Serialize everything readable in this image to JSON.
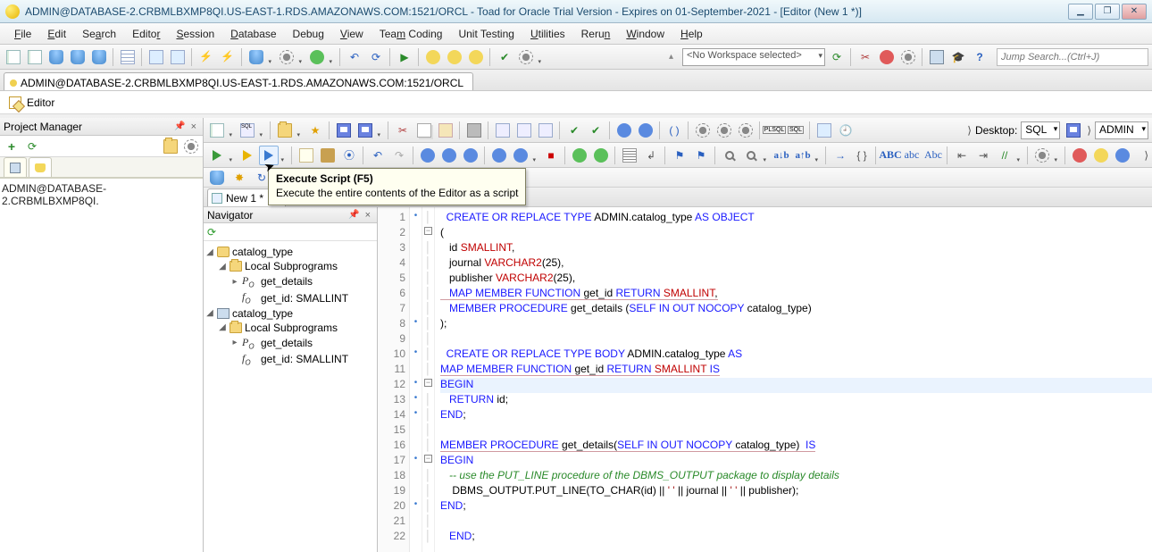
{
  "title": "ADMIN@DATABASE-2.CRBMLBXMP8QI.US-EAST-1.RDS.AMAZONAWS.COM:1521/ORCL - Toad for Oracle Trial Version - Expires on 01-September-2021 - [Editor (New 1 *)]",
  "menu": [
    "File",
    "Edit",
    "Search",
    "Editor",
    "Session",
    "Database",
    "Debug",
    "View",
    "Team Coding",
    "Unit Testing",
    "Utilities",
    "Rerun",
    "Window",
    "Help"
  ],
  "workspace_combo": "<No Workspace selected>",
  "jump_placeholder": "Jump Search...(Ctrl+J)",
  "connection_tab": "ADMIN@DATABASE-2.CRBMLBXMP8QI.US-EAST-1.RDS.AMAZONAWS.COM:1521/ORCL",
  "editor_label": "Editor",
  "project_manager": {
    "title": "Project Manager",
    "tree_root": "ADMIN@DATABASE-2.CRBMLBXMP8QI."
  },
  "desktop_label": "Desktop:",
  "desktop_value": "SQL",
  "user_value": "ADMIN",
  "tooltip": {
    "title": "Execute Script (F5)",
    "body": "Execute the entire contents of the Editor as a script"
  },
  "file_tab": {
    "label": "New 1 *",
    "prefix": "sql"
  },
  "navigator": {
    "title": "Navigator",
    "nodes": [
      {
        "lvl": 0,
        "tw": "◢",
        "icon": "type",
        "label": "catalog_type"
      },
      {
        "lvl": 1,
        "tw": "◢",
        "icon": "folder",
        "label": "Local Subprograms"
      },
      {
        "lvl": 2,
        "tw": "▸",
        "icon": "po",
        "label": "get_details"
      },
      {
        "lvl": 2,
        "tw": "",
        "icon": "fo",
        "label": "get_id: SMALLINT"
      },
      {
        "lvl": 0,
        "tw": "◢",
        "icon": "body",
        "label": "catalog_type"
      },
      {
        "lvl": 1,
        "tw": "◢",
        "icon": "folder",
        "label": "Local Subprograms"
      },
      {
        "lvl": 2,
        "tw": "▸",
        "icon": "po",
        "label": "get_details"
      },
      {
        "lvl": 2,
        "tw": "",
        "icon": "fo",
        "label": "get_id: SMALLINT"
      }
    ]
  },
  "code": {
    "lines": [
      {
        "n": 1,
        "mark": "•",
        "fold": "",
        "segs": [
          [
            "  ",
            ""
          ],
          [
            "CREATE OR REPLACE TYPE",
            "kw"
          ],
          [
            " ADMIN.catalog_type ",
            ""
          ],
          [
            "AS OBJECT",
            "kw"
          ]
        ]
      },
      {
        "n": 2,
        "mark": "",
        "fold": "[-]",
        "segs": [
          [
            "(",
            ""
          ]
        ]
      },
      {
        "n": 3,
        "mark": "",
        "fold": "",
        "segs": [
          [
            "   id ",
            ""
          ],
          [
            "SMALLINT",
            "ty"
          ],
          [
            ",",
            ""
          ]
        ]
      },
      {
        "n": 4,
        "mark": "",
        "fold": "",
        "segs": [
          [
            "   journal ",
            ""
          ],
          [
            "VARCHAR2",
            "ty"
          ],
          [
            "(",
            ""
          ],
          [
            "25",
            ""
          ],
          [
            "),",
            ""
          ]
        ]
      },
      {
        "n": 5,
        "mark": "",
        "fold": "",
        "segs": [
          [
            "   publisher ",
            ""
          ],
          [
            "VARCHAR2",
            "ty"
          ],
          [
            "(",
            ""
          ],
          [
            "25",
            ""
          ],
          [
            "),",
            ""
          ]
        ]
      },
      {
        "n": 6,
        "mark": "",
        "fold": "",
        "uline": true,
        "segs": [
          [
            "   ",
            ""
          ],
          [
            "MAP MEMBER FUNCTION",
            "kw"
          ],
          [
            " get_id ",
            ""
          ],
          [
            "RETURN",
            "kw"
          ],
          [
            " ",
            ""
          ],
          [
            "SMALLINT",
            "ty"
          ],
          [
            ",",
            ""
          ]
        ]
      },
      {
        "n": 7,
        "mark": "",
        "fold": "",
        "segs": [
          [
            "   ",
            ""
          ],
          [
            "MEMBER PROCEDURE",
            "kw"
          ],
          [
            " get_details (",
            ""
          ],
          [
            "SELF IN OUT NOCOPY",
            "kw"
          ],
          [
            " catalog_type)",
            ""
          ]
        ]
      },
      {
        "n": 8,
        "mark": "•",
        "fold": "",
        "segs": [
          [
            ");",
            ""
          ]
        ]
      },
      {
        "n": 9,
        "mark": "",
        "fold": "",
        "segs": [
          [
            "",
            ""
          ]
        ]
      },
      {
        "n": 10,
        "mark": "•",
        "fold": "",
        "segs": [
          [
            "  ",
            ""
          ],
          [
            "CREATE OR REPLACE TYPE BODY",
            "kw"
          ],
          [
            " ADMIN.catalog_type ",
            ""
          ],
          [
            "AS",
            "kw"
          ]
        ]
      },
      {
        "n": 11,
        "mark": "",
        "fold": "",
        "uline": true,
        "segs": [
          [
            "",
            ""
          ],
          [
            "MAP MEMBER FUNCTION",
            "kw"
          ],
          [
            " get_id ",
            ""
          ],
          [
            "RETURN",
            "kw"
          ],
          [
            " ",
            ""
          ],
          [
            "SMALLINT",
            "ty"
          ],
          [
            " ",
            ""
          ],
          [
            "IS",
            "kw"
          ]
        ]
      },
      {
        "n": 12,
        "mark": "•",
        "fold": "[-]",
        "caret": true,
        "segs": [
          [
            "",
            ""
          ],
          [
            "BEGIN",
            "kw"
          ]
        ]
      },
      {
        "n": 13,
        "mark": "•",
        "fold": "",
        "segs": [
          [
            "   ",
            ""
          ],
          [
            "RETURN",
            "kw"
          ],
          [
            " id;",
            ""
          ]
        ]
      },
      {
        "n": 14,
        "mark": "•",
        "fold": "",
        "segs": [
          [
            "",
            ""
          ],
          [
            "END",
            "kw"
          ],
          [
            ";",
            ""
          ]
        ]
      },
      {
        "n": 15,
        "mark": "",
        "fold": "",
        "segs": [
          [
            "",
            ""
          ]
        ]
      },
      {
        "n": 16,
        "mark": "",
        "fold": "",
        "uline": true,
        "segs": [
          [
            "",
            ""
          ],
          [
            "MEMBER PROCEDURE",
            "kw"
          ],
          [
            " get_details(",
            ""
          ],
          [
            "SELF IN OUT NOCOPY",
            "kw"
          ],
          [
            " catalog_type)  ",
            ""
          ],
          [
            "IS",
            "kw"
          ]
        ]
      },
      {
        "n": 17,
        "mark": "•",
        "fold": "[-]",
        "segs": [
          [
            "",
            ""
          ],
          [
            "BEGIN",
            "kw"
          ]
        ]
      },
      {
        "n": 18,
        "mark": "",
        "fold": "",
        "segs": [
          [
            "   ",
            ""
          ],
          [
            "-- use the PUT_LINE procedure of the DBMS_OUTPUT package to display details",
            "cm"
          ]
        ]
      },
      {
        "n": 19,
        "mark": "",
        "fold": "",
        "segs": [
          [
            "    DBMS_OUTPUT.PUT_LINE(TO_CHAR(id) || ",
            ""
          ],
          [
            "' '",
            "str"
          ],
          [
            " || journal || ",
            ""
          ],
          [
            "' '",
            "str"
          ],
          [
            " || publisher);",
            ""
          ]
        ]
      },
      {
        "n": 20,
        "mark": "•",
        "fold": "",
        "segs": [
          [
            "",
            ""
          ],
          [
            "END",
            "kw"
          ],
          [
            ";",
            ""
          ]
        ]
      },
      {
        "n": 21,
        "mark": "",
        "fold": "",
        "segs": [
          [
            "",
            ""
          ]
        ]
      },
      {
        "n": 22,
        "mark": "",
        "fold": "",
        "segs": [
          [
            "   ",
            ""
          ],
          [
            "END",
            "kw"
          ],
          [
            ";",
            ""
          ]
        ]
      }
    ]
  }
}
